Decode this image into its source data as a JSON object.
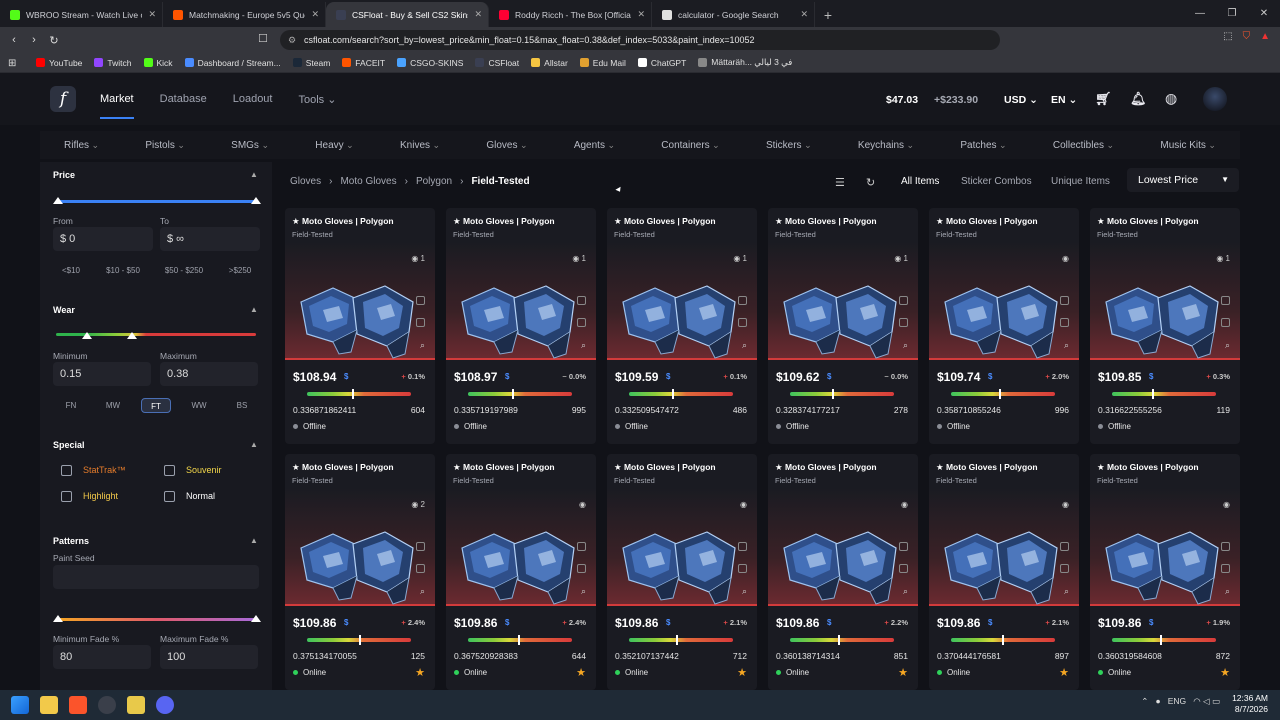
{
  "browser": {
    "tabs": [
      {
        "title": "WBROO Stream - Watch Live on",
        "color": "#53fc18"
      },
      {
        "title": "Matchmaking - Europe 5v5 Queue -",
        "color": "#ff5500"
      },
      {
        "title": "CSFloat - Buy & Sell CS2 Skins on",
        "color": "#3a3f52"
      },
      {
        "title": "Roddy Ricch - The Box [Official A",
        "color": "#ff0033"
      },
      {
        "title": "calculator - Google Search",
        "color": "#e0e0e0"
      }
    ],
    "url": "csfloat.com/search?sort_by=lowest_price&min_float=0.15&max_float=0.38&def_index=5033&paint_index=10052",
    "bookmarks": [
      {
        "label": "YouTube",
        "color": "#ff0000"
      },
      {
        "label": "Twitch",
        "color": "#9146ff"
      },
      {
        "label": "Kick",
        "color": "#53fc18"
      },
      {
        "label": "Dashboard / Stream...",
        "color": "#4a8cff"
      },
      {
        "label": "Steam",
        "color": "#1b2838"
      },
      {
        "label": "FACEIT",
        "color": "#ff5500"
      },
      {
        "label": "CSGO-SKINS",
        "color": "#4aa3ff"
      },
      {
        "label": "CSFloat",
        "color": "#3a3f52"
      },
      {
        "label": "Allstar",
        "color": "#f5c542"
      },
      {
        "label": "Edu Mail",
        "color": "#e0a030"
      },
      {
        "label": "ChatGPT",
        "color": "#ffffff"
      },
      {
        "label": "Mättaräh... في 3 ليالي",
        "color": "#888888"
      }
    ]
  },
  "header": {
    "nav": [
      "Market",
      "Database",
      "Loadout",
      "Tools"
    ],
    "balance": "$47.03",
    "pending": "+$233.90",
    "currency": "USD",
    "lang": "EN"
  },
  "categories": [
    "Rifles",
    "Pistols",
    "SMGs",
    "Heavy",
    "Knives",
    "Gloves",
    "Agents",
    "Containers",
    "Stickers",
    "Keychains",
    "Patches",
    "Collectibles",
    "Music Kits"
  ],
  "sidebar": {
    "price_title": "Price",
    "from_label": "From",
    "to_label": "To",
    "from_value": "$ 0",
    "to_value": "$ ∞",
    "price_chips": [
      "<$10",
      "$10 - $50",
      "$50 - $250",
      ">$250"
    ],
    "wear_title": "Wear",
    "min_label": "Minimum",
    "max_label": "Maximum",
    "min_value": "0.15",
    "max_value": "0.38",
    "wear_buttons": [
      "FN",
      "MW",
      "FT",
      "WW",
      "BS"
    ],
    "special_title": "Special",
    "stattrak": "StatTrak™",
    "souvenir": "Souvenir",
    "highlight": "Highlight",
    "normal": "Normal",
    "patterns_title": "Patterns",
    "paint_seed_label": "Paint Seed",
    "min_fade_label": "Minimum Fade %",
    "max_fade_label": "Maximum Fade %",
    "min_fade": "80",
    "max_fade": "100"
  },
  "breadcrumb": [
    "Gloves",
    "Moto Gloves",
    "Polygon",
    "Field-Tested"
  ],
  "toolbar": {
    "all_items": "All Items",
    "sticker_combos": "Sticker Combos",
    "unique_items": "Unique Items",
    "sort": "Lowest Price"
  },
  "item_name": "★ Moto Gloves | Polygon",
  "item_wear": "Field-Tested",
  "listings": [
    {
      "price": "$108.94",
      "pct": "0.1%",
      "float": "0.336871862411",
      "seed": "604",
      "status": "Offline",
      "views": "1",
      "pos": 0.43
    },
    {
      "price": "$108.97",
      "pct": "0.0%",
      "float": "0.335719197989",
      "seed": "995",
      "status": "Offline",
      "views": "1",
      "pos": 0.42
    },
    {
      "price": "$109.59",
      "pct": "0.1%",
      "float": "0.332509547472",
      "seed": "486",
      "status": "Offline",
      "views": "1",
      "pos": 0.41
    },
    {
      "price": "$109.62",
      "pct": "0.0%",
      "float": "0.328374177217",
      "seed": "278",
      "status": "Offline",
      "views": "1",
      "pos": 0.4
    },
    {
      "price": "$109.74",
      "pct": "2.0%",
      "float": "0.358710855246",
      "seed": "996",
      "status": "Offline",
      "views": "",
      "pos": 0.46
    },
    {
      "price": "$109.85",
      "pct": "0.3%",
      "float": "0.316622555256",
      "seed": "119",
      "status": "Offline",
      "views": "1",
      "pos": 0.38
    },
    {
      "price": "$109.86",
      "pct": "2.4%",
      "float": "0.375134170055",
      "seed": "125",
      "status": "Online",
      "views": "2",
      "pos": 0.5
    },
    {
      "price": "$109.86",
      "pct": "2.4%",
      "float": "0.367520928383",
      "seed": "644",
      "status": "Online",
      "views": "",
      "pos": 0.48
    },
    {
      "price": "$109.86",
      "pct": "2.1%",
      "float": "0.352107137442",
      "seed": "712",
      "status": "Online",
      "views": "",
      "pos": 0.45
    },
    {
      "price": "$109.86",
      "pct": "2.2%",
      "float": "0.360138714314",
      "seed": "851",
      "status": "Online",
      "views": "",
      "pos": 0.46
    },
    {
      "price": "$109.86",
      "pct": "2.1%",
      "float": "0.370444176581",
      "seed": "897",
      "status": "Online",
      "views": "",
      "pos": 0.49
    },
    {
      "price": "$109.86",
      "pct": "1.9%",
      "float": "0.360319584608",
      "seed": "872",
      "status": "Online",
      "views": "",
      "pos": 0.46
    }
  ],
  "taskbar": {
    "tray_lang": "ENG",
    "time": "12:36 AM",
    "date": "8/7/2026"
  }
}
